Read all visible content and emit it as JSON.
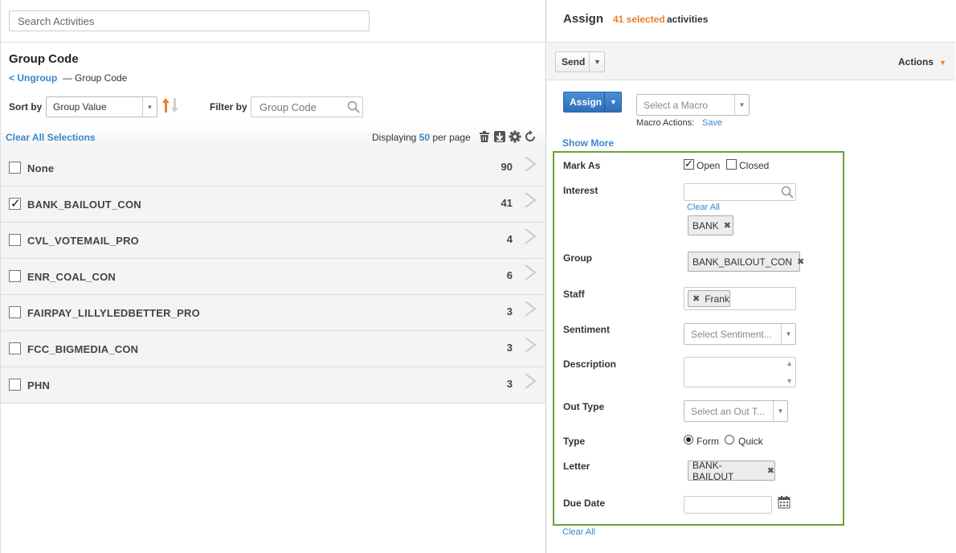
{
  "search": {
    "placeholder": "Search Activities"
  },
  "group": {
    "title": "Group Code",
    "ungroup_label": "< Ungroup",
    "separator": "—",
    "breadcrumb_current": "Group Code"
  },
  "sort": {
    "label": "Sort by",
    "value": "Group Value"
  },
  "filter": {
    "label": "Filter by",
    "placeholder": "Group Code"
  },
  "list_toolbar": {
    "clear_all": "Clear All Selections",
    "displaying_prefix": "Displaying",
    "per_page": "50",
    "displaying_suffix": "per page"
  },
  "rows": [
    {
      "label": "None",
      "count": "90",
      "checked": false
    },
    {
      "label": "BANK_BAILOUT_CON",
      "count": "41",
      "checked": true
    },
    {
      "label": "CVL_VOTEMAIL_PRO",
      "count": "4",
      "checked": false
    },
    {
      "label": "ENR_COAL_CON",
      "count": "6",
      "checked": false
    },
    {
      "label": "FAIRPAY_LILLYLEDBETTER_PRO",
      "count": "3",
      "checked": false
    },
    {
      "label": "FCC_BIGMEDIA_CON",
      "count": "3",
      "checked": false
    },
    {
      "label": "PHN",
      "count": "3",
      "checked": false
    }
  ],
  "assign_panel": {
    "title": "Assign",
    "selected_count": "41 selected",
    "selected_suffix": "activities",
    "send_label": "Send",
    "actions_label": "Actions",
    "assign_button": "Assign",
    "macro_placeholder": "Select a Macro",
    "macro_actions_label": "Macro Actions:",
    "macro_save": "Save",
    "show_more": "Show More"
  },
  "form": {
    "mark_as": {
      "label": "Mark As",
      "open": "Open",
      "closed": "Closed",
      "open_checked": true,
      "closed_checked": false
    },
    "interest": {
      "label": "Interest",
      "clear_all": "Clear All",
      "tags": [
        "BANK"
      ]
    },
    "group": {
      "label": "Group",
      "tags": [
        "BANK_BAILOUT_CON"
      ]
    },
    "staff": {
      "label": "Staff",
      "tags": [
        "Frank"
      ]
    },
    "sentiment": {
      "label": "Sentiment",
      "placeholder": "Select Sentiment..."
    },
    "description": {
      "label": "Description"
    },
    "out_type": {
      "label": "Out Type",
      "placeholder": "Select an Out T..."
    },
    "type": {
      "label": "Type",
      "form": "Form",
      "quick": "Quick",
      "selected": "Form"
    },
    "letter": {
      "label": "Letter",
      "tags": [
        "BANK-BAILOUT"
      ]
    },
    "due_date": {
      "label": "Due Date"
    },
    "clear_all": "Clear All"
  },
  "colors": {
    "link": "#3a86c8",
    "accent": "#e8802c",
    "form_border": "#6aa23a",
    "primary_button": "#2d6fb8"
  },
  "icons": [
    "search-icon",
    "sort-direction-icon",
    "trash-icon",
    "download-icon",
    "gear-icon",
    "refresh-icon",
    "chevron-right-icon",
    "calendar-icon",
    "close-icon"
  ]
}
